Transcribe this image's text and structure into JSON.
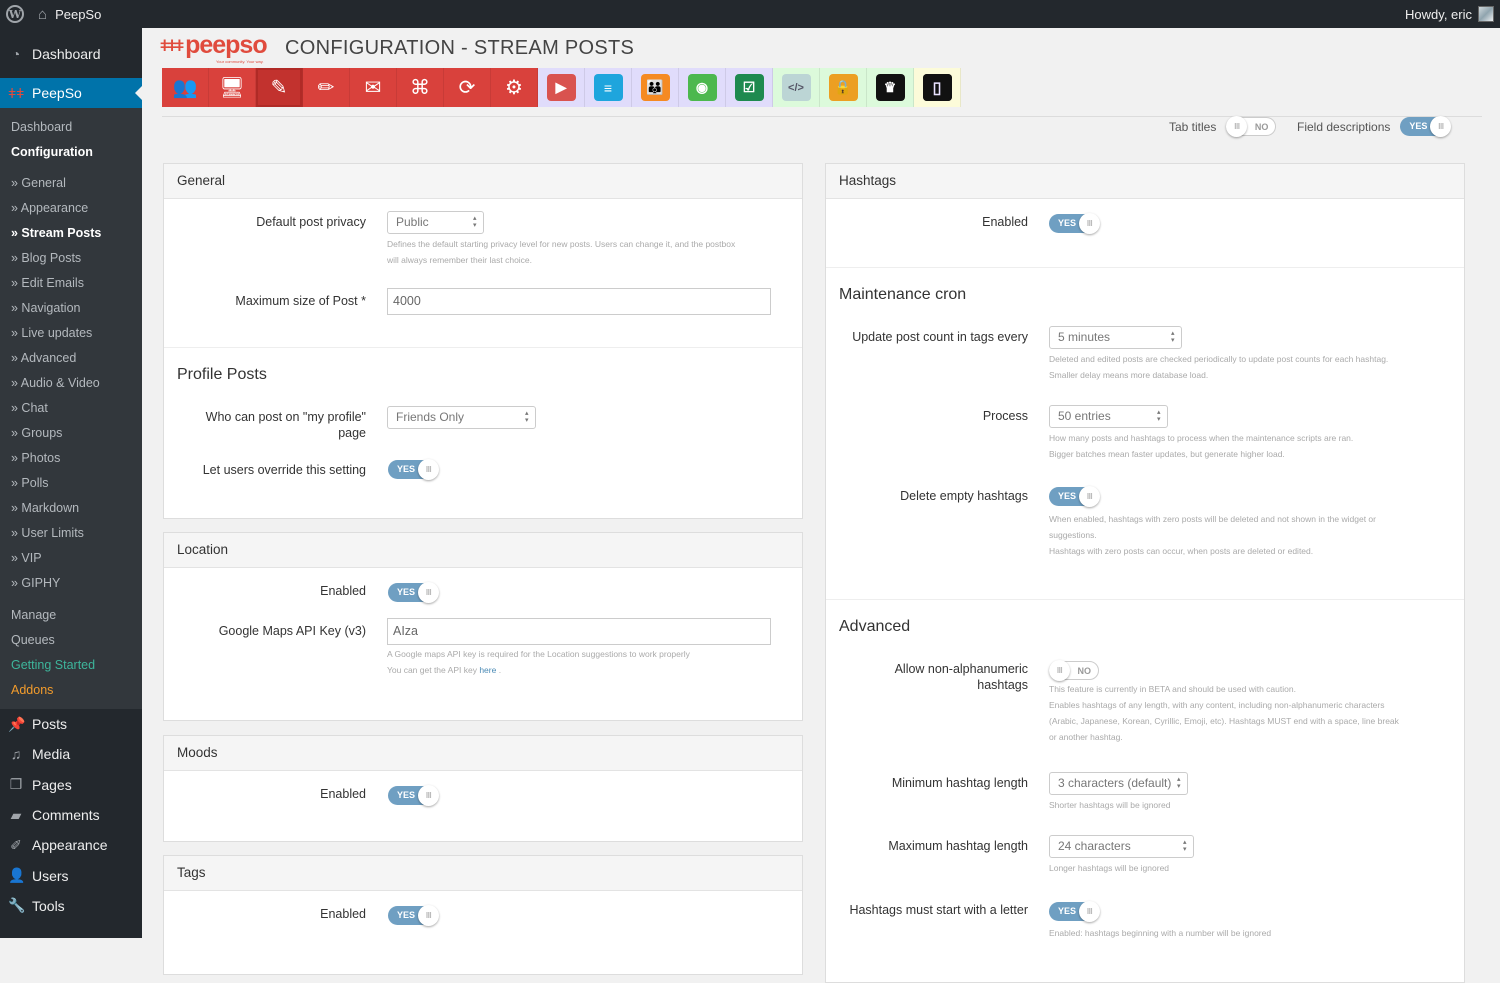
{
  "adminbar": {
    "site_name": "PeepSo",
    "greeting": "Howdy, eric"
  },
  "sidebar": {
    "top_items": [
      {
        "label": "Dashboard",
        "icon": "dashboard-icon"
      },
      {
        "label": "PeepSo",
        "icon": "peepso-icon",
        "active": true
      }
    ],
    "submenu": [
      {
        "label": "Dashboard"
      },
      {
        "label": "Configuration",
        "current": true
      },
      {
        "label": "» General"
      },
      {
        "label": "» Appearance"
      },
      {
        "label": "» Stream Posts",
        "current": true
      },
      {
        "label": "» Blog Posts"
      },
      {
        "label": "» Edit Emails"
      },
      {
        "label": "» Navigation"
      },
      {
        "label": "» Live updates"
      },
      {
        "label": "» Advanced"
      },
      {
        "label": "» Audio & Video"
      },
      {
        "label": "» Chat"
      },
      {
        "label": "» Groups"
      },
      {
        "label": "» Photos"
      },
      {
        "label": "» Polls"
      },
      {
        "label": "» Markdown"
      },
      {
        "label": "» User Limits"
      },
      {
        "label": "» VIP"
      },
      {
        "label": "» GIPHY"
      },
      {
        "label": "Manage"
      },
      {
        "label": "Queues"
      },
      {
        "label": "Getting Started",
        "color": "#3db59b"
      },
      {
        "label": "Addons",
        "color": "#f39c2c"
      }
    ],
    "wp_items": [
      {
        "label": "Posts",
        "icon": "pin-icon"
      },
      {
        "label": "Media",
        "icon": "media-icon"
      },
      {
        "label": "Pages",
        "icon": "pages-icon"
      },
      {
        "label": "Comments",
        "icon": "comment-icon"
      },
      {
        "label": "Appearance",
        "icon": "brush-icon"
      },
      {
        "label": "Users",
        "icon": "user-icon"
      },
      {
        "label": "Tools",
        "icon": "wrench-icon"
      }
    ]
  },
  "header": {
    "logo_text": "peepso",
    "logo_tagline": "Your community. Your way.",
    "title_main": "CONFIGURATION",
    "title_sep": " - ",
    "title_sub": "STREAM POSTS"
  },
  "toolbar": {
    "tabs": [
      {
        "name": "community-icon",
        "glyph": "👥",
        "group": "red"
      },
      {
        "name": "appearance-icon",
        "glyph": "🖥",
        "group": "red"
      },
      {
        "name": "stream-posts-icon",
        "glyph": "✎",
        "group": "red",
        "active": true
      },
      {
        "name": "blog-posts-icon",
        "glyph": "✏",
        "group": "red"
      },
      {
        "name": "edit-emails-icon",
        "glyph": "✉",
        "group": "red"
      },
      {
        "name": "navigation-icon",
        "glyph": "⌘",
        "group": "red"
      },
      {
        "name": "live-updates-icon",
        "glyph": "⟳",
        "group": "red"
      },
      {
        "name": "advanced-icon",
        "glyph": "⚙",
        "group": "red"
      },
      {
        "name": "audio-video-icon",
        "glyph": "▶",
        "group": "violet",
        "color": "#d9534f"
      },
      {
        "name": "chat-icon",
        "glyph": "≡",
        "group": "violet",
        "color": "#1ea5dd"
      },
      {
        "name": "groups-icon",
        "glyph": "👪",
        "group": "violet",
        "color": "#f58a22"
      },
      {
        "name": "photos-icon",
        "glyph": "◉",
        "group": "violet",
        "color": "#4cb84e"
      },
      {
        "name": "polls-icon",
        "glyph": "☑",
        "group": "violet",
        "color": "#1e8a4f"
      },
      {
        "name": "markdown-icon",
        "glyph": "</>",
        "group": "mint",
        "color": "#bcd5d5"
      },
      {
        "name": "user-limits-icon",
        "glyph": "🔒",
        "group": "mint",
        "color": "#ec9f22"
      },
      {
        "name": "vip-icon",
        "glyph": "♛",
        "group": "mint",
        "color": "#111111"
      },
      {
        "name": "giphy-icon",
        "glyph": "▯",
        "group": "cream",
        "color": "#111111"
      }
    ]
  },
  "options": {
    "tab_titles": {
      "label": "Tab titles",
      "value": "NO"
    },
    "field_descriptions": {
      "label": "Field descriptions",
      "value": "YES"
    }
  },
  "general": {
    "title": "General",
    "privacy": {
      "label": "Default post privacy",
      "value": "Public",
      "hint1": "Defines the default starting privacy level for new posts. Users can change it, and the postbox",
      "hint2": "will always remember their last choice."
    },
    "maxsize": {
      "label": "Maximum size of Post *",
      "value": "4000"
    },
    "profile_title": "Profile Posts",
    "who": {
      "label1": "Who can post on \"my profile\"",
      "label2": "page",
      "value": "Friends Only"
    },
    "override": {
      "label": "Let users override this setting",
      "value": "YES"
    }
  },
  "location": {
    "title": "Location",
    "enabled": {
      "label": "Enabled",
      "value": "YES"
    },
    "apikey": {
      "label": "Google Maps API Key (v3)",
      "value": "AIza",
      "hint1": "A Google maps API key is required for the Location suggestions to work properly",
      "hint2": "You can get the API key ",
      "link": "here",
      "hint_end": " ."
    }
  },
  "moods": {
    "title": "Moods",
    "enabled": {
      "label": "Enabled",
      "value": "YES"
    }
  },
  "tags": {
    "title": "Tags",
    "enabled": {
      "label": "Enabled",
      "value": "YES"
    }
  },
  "hashtags": {
    "title": "Hashtags",
    "enabled": {
      "label": "Enabled",
      "value": "YES"
    },
    "cron_title": "Maintenance cron",
    "update": {
      "label": "Update post count in tags every",
      "value": "5 minutes",
      "hint1": "Deleted and edited posts are checked periodically to update post counts for each hashtag.",
      "hint2": "Smaller delay means more database load."
    },
    "process": {
      "label": "Process",
      "value": "50 entries",
      "hint1": "How many posts and hashtags to process when the maintenance scripts are ran.",
      "hint2": "Bigger batches mean faster updates, but generate higher load."
    },
    "delete": {
      "label": "Delete empty hashtags",
      "value": "YES",
      "hint1": "When enabled, hashtags with zero posts will be deleted and not shown in the widget or",
      "hint2": "suggestions.",
      "hint3": "Hashtags with zero posts can occur, when posts are deleted or edited."
    },
    "advanced_title": "Advanced",
    "nonalpha": {
      "label1": "Allow non-alphanumeric",
      "label2": "hashtags",
      "value": "NO",
      "hint1": "This feature is currently in BETA and should be used with caution.",
      "hint2": "Enables hashtags of any length, with any content, including non-alphanumeric characters",
      "hint3": "(Arabic, Japanese, Korean, Cyrillic, Emoji, etc). Hashtags MUST end with a space, line break",
      "hint4": "or another hashtag."
    },
    "minlen": {
      "label": "Minimum hashtag length",
      "value": "3 characters (default)",
      "hint": "Shorter hashtags will be ignored"
    },
    "maxlen": {
      "label": "Maximum hashtag length",
      "value": "24 characters",
      "hint": "Longer hashtags will be ignored"
    },
    "letter": {
      "label": "Hashtags must start with a letter",
      "value": "YES",
      "hint": "Enabled: hashtags beginning with a number will be ignored"
    }
  },
  "colors": {
    "accent_red": "#d9413c",
    "wp_blue": "#0073aa",
    "toggle_on": "#6f9fc2"
  }
}
